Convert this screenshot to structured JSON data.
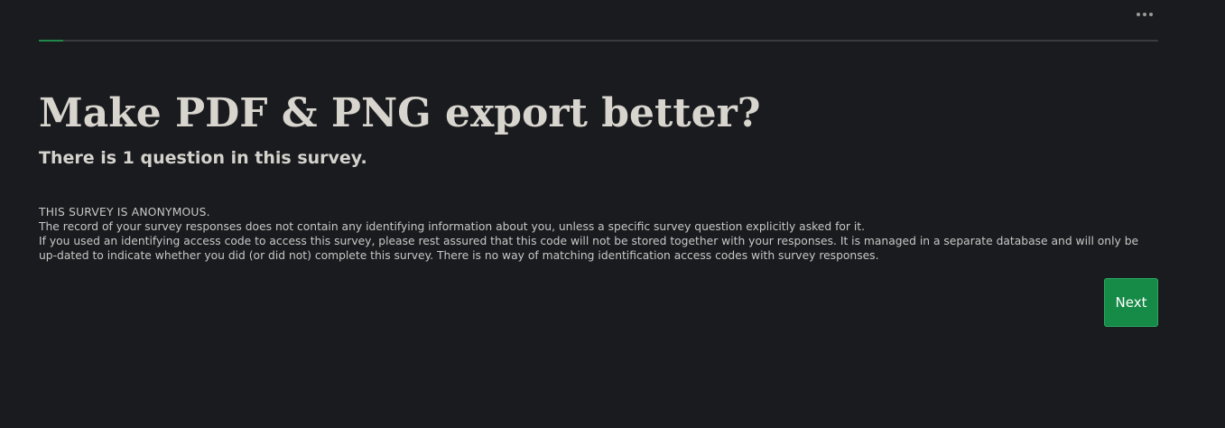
{
  "header": {
    "menu_icon": "more-horizontal-icon",
    "progress_fraction": 0.022
  },
  "survey": {
    "title": "Make PDF & PNG export better?",
    "question_count_text": "There is 1 question in this survey."
  },
  "privacy": {
    "heading": "THIS SURVEY IS ANONYMOUS.",
    "line1": "The record of your survey responses does not contain any identifying information about you, unless a specific survey question explicitly asked for it.",
    "line2": "If you used an identifying access code to access this survey, please rest assured that this code will not be stored together with your responses. It is managed in a separate database and will only be up-dated to indicate whether you did (or did not) complete this survey. There is no way of matching identification access codes with survey responses."
  },
  "actions": {
    "next_label": "Next"
  },
  "colors": {
    "background": "#1a1b1e",
    "accent": "#168a47",
    "progress_track": "#3a3b3e",
    "text": "#d4d2cd"
  }
}
